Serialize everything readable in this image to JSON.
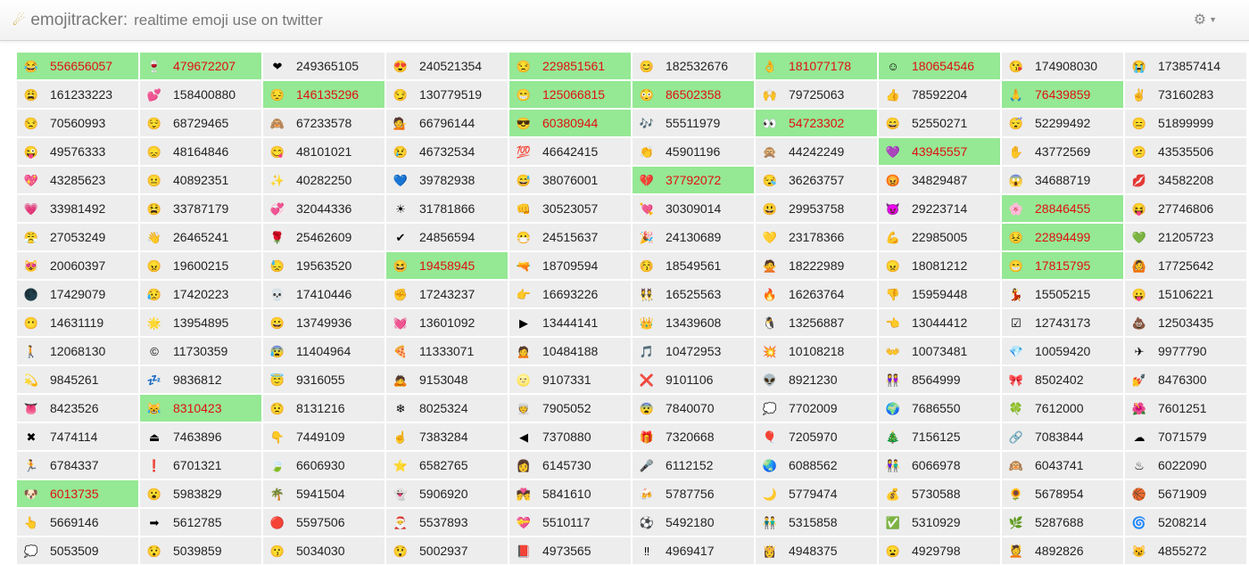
{
  "header": {
    "title": "emojitracker:",
    "subtitle": "realtime emoji use on twitter",
    "logo_icon": "comet-icon",
    "settings_icon": "gears-icon"
  },
  "colors": {
    "highlight_bg": "#95e894",
    "highlight_text": "#e01010",
    "cell_bg": "#ededed"
  },
  "emoji_cells": [
    {
      "emoji": "😂",
      "count": "556656057",
      "highlight": true
    },
    {
      "emoji": "🍷",
      "count": "479672207",
      "highlight": true
    },
    {
      "emoji": "❤",
      "count": "249365105",
      "highlight": false
    },
    {
      "emoji": "😍",
      "count": "240521354",
      "highlight": false
    },
    {
      "emoji": "😒",
      "count": "229851561",
      "highlight": true
    },
    {
      "emoji": "😊",
      "count": "182532676",
      "highlight": false
    },
    {
      "emoji": "👌",
      "count": "181077178",
      "highlight": true
    },
    {
      "emoji": "☺",
      "count": "180654546",
      "highlight": true
    },
    {
      "emoji": "😘",
      "count": "174908030",
      "highlight": false
    },
    {
      "emoji": "😭",
      "count": "173857414",
      "highlight": false
    },
    {
      "emoji": "😩",
      "count": "161233223",
      "highlight": false
    },
    {
      "emoji": "💕",
      "count": "158400880",
      "highlight": false
    },
    {
      "emoji": "😔",
      "count": "146135296",
      "highlight": true
    },
    {
      "emoji": "😏",
      "count": "130779519",
      "highlight": false
    },
    {
      "emoji": "😁",
      "count": "125066815",
      "highlight": true
    },
    {
      "emoji": "😳",
      "count": "86502358",
      "highlight": true
    },
    {
      "emoji": "🙌",
      "count": "79725063",
      "highlight": false
    },
    {
      "emoji": "👍",
      "count": "78592204",
      "highlight": false
    },
    {
      "emoji": "🙏",
      "count": "76439859",
      "highlight": true
    },
    {
      "emoji": "✌",
      "count": "73160283",
      "highlight": false
    },
    {
      "emoji": "😒",
      "count": "70560993",
      "highlight": false
    },
    {
      "emoji": "😌",
      "count": "68729465",
      "highlight": false
    },
    {
      "emoji": "🙈",
      "count": "67233578",
      "highlight": false
    },
    {
      "emoji": "💁",
      "count": "66796144",
      "highlight": false
    },
    {
      "emoji": "😎",
      "count": "60380944",
      "highlight": true
    },
    {
      "emoji": "🎶",
      "count": "55511979",
      "highlight": false
    },
    {
      "emoji": "👀",
      "count": "54723302",
      "highlight": true
    },
    {
      "emoji": "😄",
      "count": "52550271",
      "highlight": false
    },
    {
      "emoji": "😴",
      "count": "52299492",
      "highlight": false
    },
    {
      "emoji": "😑",
      "count": "51899999",
      "highlight": false
    },
    {
      "emoji": "😜",
      "count": "49576333",
      "highlight": false
    },
    {
      "emoji": "😞",
      "count": "48164846",
      "highlight": false
    },
    {
      "emoji": "😋",
      "count": "48101021",
      "highlight": false
    },
    {
      "emoji": "😢",
      "count": "46732534",
      "highlight": false
    },
    {
      "emoji": "💯",
      "count": "46642415",
      "highlight": false
    },
    {
      "emoji": "👏",
      "count": "45901196",
      "highlight": false
    },
    {
      "emoji": "🙊",
      "count": "44242249",
      "highlight": false
    },
    {
      "emoji": "💜",
      "count": "43945557",
      "highlight": true
    },
    {
      "emoji": "✋",
      "count": "43772569",
      "highlight": false
    },
    {
      "emoji": "😕",
      "count": "43535506",
      "highlight": false
    },
    {
      "emoji": "💖",
      "count": "43285623",
      "highlight": false
    },
    {
      "emoji": "😐",
      "count": "40892351",
      "highlight": false
    },
    {
      "emoji": "✨",
      "count": "40282250",
      "highlight": false
    },
    {
      "emoji": "💙",
      "count": "39782938",
      "highlight": false
    },
    {
      "emoji": "😅",
      "count": "38076001",
      "highlight": false
    },
    {
      "emoji": "💔",
      "count": "37792072",
      "highlight": true
    },
    {
      "emoji": "😪",
      "count": "36263757",
      "highlight": false
    },
    {
      "emoji": "😡",
      "count": "34829487",
      "highlight": false
    },
    {
      "emoji": "😱",
      "count": "34688719",
      "highlight": false
    },
    {
      "emoji": "💋",
      "count": "34582208",
      "highlight": false
    },
    {
      "emoji": "💗",
      "count": "33981492",
      "highlight": false
    },
    {
      "emoji": "😫",
      "count": "33787179",
      "highlight": false
    },
    {
      "emoji": "💞",
      "count": "32044336",
      "highlight": false
    },
    {
      "emoji": "☀",
      "count": "31781866",
      "highlight": false
    },
    {
      "emoji": "👊",
      "count": "30523057",
      "highlight": false
    },
    {
      "emoji": "💘",
      "count": "30309014",
      "highlight": false
    },
    {
      "emoji": "😃",
      "count": "29953758",
      "highlight": false
    },
    {
      "emoji": "😈",
      "count": "29223714",
      "highlight": false
    },
    {
      "emoji": "🌸",
      "count": "28846455",
      "highlight": true
    },
    {
      "emoji": "😝",
      "count": "27746806",
      "highlight": false
    },
    {
      "emoji": "😤",
      "count": "27053249",
      "highlight": false
    },
    {
      "emoji": "👋",
      "count": "26465241",
      "highlight": false
    },
    {
      "emoji": "🌹",
      "count": "25462609",
      "highlight": false
    },
    {
      "emoji": "✔",
      "count": "24856594",
      "highlight": false
    },
    {
      "emoji": "😷",
      "count": "24515637",
      "highlight": false
    },
    {
      "emoji": "🎉",
      "count": "24130689",
      "highlight": false
    },
    {
      "emoji": "💛",
      "count": "23178366",
      "highlight": false
    },
    {
      "emoji": "💪",
      "count": "22985005",
      "highlight": false
    },
    {
      "emoji": "😣",
      "count": "22894499",
      "highlight": true
    },
    {
      "emoji": "💚",
      "count": "21205723",
      "highlight": false
    },
    {
      "emoji": "😻",
      "count": "20060397",
      "highlight": false
    },
    {
      "emoji": "😠",
      "count": "19600215",
      "highlight": false
    },
    {
      "emoji": "😓",
      "count": "19563520",
      "highlight": false
    },
    {
      "emoji": "😆",
      "count": "19458945",
      "highlight": true
    },
    {
      "emoji": "🔫",
      "count": "18709594",
      "highlight": false
    },
    {
      "emoji": "😚",
      "count": "18549561",
      "highlight": false
    },
    {
      "emoji": "🙅",
      "count": "18222989",
      "highlight": false
    },
    {
      "emoji": "😠",
      "count": "18081212",
      "highlight": false
    },
    {
      "emoji": "😁",
      "count": "17815795",
      "highlight": true
    },
    {
      "emoji": "🙆",
      "count": "17725642",
      "highlight": false
    },
    {
      "emoji": "🌑",
      "count": "17429079",
      "highlight": false
    },
    {
      "emoji": "😥",
      "count": "17420223",
      "highlight": false
    },
    {
      "emoji": "💀",
      "count": "17410446",
      "highlight": false
    },
    {
      "emoji": "✊",
      "count": "17243237",
      "highlight": false
    },
    {
      "emoji": "👉",
      "count": "16693226",
      "highlight": false
    },
    {
      "emoji": "👯",
      "count": "16525563",
      "highlight": false
    },
    {
      "emoji": "🔥",
      "count": "16263764",
      "highlight": false
    },
    {
      "emoji": "👎",
      "count": "15959448",
      "highlight": false
    },
    {
      "emoji": "💃",
      "count": "15505215",
      "highlight": false
    },
    {
      "emoji": "😛",
      "count": "15106221",
      "highlight": false
    },
    {
      "emoji": "😶",
      "count": "14631119",
      "highlight": false
    },
    {
      "emoji": "🌟",
      "count": "13954895",
      "highlight": false
    },
    {
      "emoji": "😀",
      "count": "13749936",
      "highlight": false
    },
    {
      "emoji": "💓",
      "count": "13601092",
      "highlight": false
    },
    {
      "emoji": "▶",
      "count": "13444141",
      "highlight": false
    },
    {
      "emoji": "👑",
      "count": "13439608",
      "highlight": false
    },
    {
      "emoji": "🐧",
      "count": "13256887",
      "highlight": false
    },
    {
      "emoji": "👈",
      "count": "13044412",
      "highlight": false
    },
    {
      "emoji": "☑",
      "count": "12743173",
      "highlight": false
    },
    {
      "emoji": "💩",
      "count": "12503435",
      "highlight": false
    },
    {
      "emoji": "🚶",
      "count": "12068130",
      "highlight": false
    },
    {
      "emoji": "©",
      "count": "11730359",
      "highlight": false
    },
    {
      "emoji": "😰",
      "count": "11404964",
      "highlight": false
    },
    {
      "emoji": "🍕",
      "count": "11333071",
      "highlight": false
    },
    {
      "emoji": "🙍",
      "count": "10484188",
      "highlight": false
    },
    {
      "emoji": "🎵",
      "count": "10472953",
      "highlight": false
    },
    {
      "emoji": "💥",
      "count": "10108218",
      "highlight": false
    },
    {
      "emoji": "👐",
      "count": "10073481",
      "highlight": false
    },
    {
      "emoji": "💎",
      "count": "10059420",
      "highlight": false
    },
    {
      "emoji": "✈",
      "count": "9977790",
      "highlight": false
    },
    {
      "emoji": "💫",
      "count": "9845261",
      "highlight": false
    },
    {
      "emoji": "💤",
      "count": "9836812",
      "highlight": false
    },
    {
      "emoji": "😇",
      "count": "9316055",
      "highlight": false
    },
    {
      "emoji": "🙇",
      "count": "9153048",
      "highlight": false
    },
    {
      "emoji": "🌝",
      "count": "9107331",
      "highlight": false
    },
    {
      "emoji": "❌",
      "count": "9101106",
      "highlight": false
    },
    {
      "emoji": "👽",
      "count": "8921230",
      "highlight": false
    },
    {
      "emoji": "👭",
      "count": "8564999",
      "highlight": false
    },
    {
      "emoji": "🎀",
      "count": "8502402",
      "highlight": false
    },
    {
      "emoji": "💅",
      "count": "8476300",
      "highlight": false
    },
    {
      "emoji": "👅",
      "count": "8423526",
      "highlight": false
    },
    {
      "emoji": "😹",
      "count": "8310423",
      "highlight": true
    },
    {
      "emoji": "😟",
      "count": "8131216",
      "highlight": false
    },
    {
      "emoji": "❄",
      "count": "8025324",
      "highlight": false
    },
    {
      "emoji": "👳",
      "count": "7905052",
      "highlight": false
    },
    {
      "emoji": "😨",
      "count": "7840070",
      "highlight": false
    },
    {
      "emoji": "💭",
      "count": "7702009",
      "highlight": false
    },
    {
      "emoji": "🌍",
      "count": "7686550",
      "highlight": false
    },
    {
      "emoji": "🍀",
      "count": "7612000",
      "highlight": false
    },
    {
      "emoji": "🌺",
      "count": "7601251",
      "highlight": false
    },
    {
      "emoji": "✖",
      "count": "7474114",
      "highlight": false
    },
    {
      "emoji": "⏏",
      "count": "7463896",
      "highlight": false
    },
    {
      "emoji": "👇",
      "count": "7449109",
      "highlight": false
    },
    {
      "emoji": "☝",
      "count": "7383284",
      "highlight": false
    },
    {
      "emoji": "◀",
      "count": "7370880",
      "highlight": false
    },
    {
      "emoji": "🎁",
      "count": "7320668",
      "highlight": false
    },
    {
      "emoji": "🎈",
      "count": "7205970",
      "highlight": false
    },
    {
      "emoji": "🎄",
      "count": "7156125",
      "highlight": false
    },
    {
      "emoji": "🔗",
      "count": "7083844",
      "highlight": false
    },
    {
      "emoji": "☁",
      "count": "7071579",
      "highlight": false
    },
    {
      "emoji": "🏃",
      "count": "6784337",
      "highlight": false
    },
    {
      "emoji": "❗",
      "count": "6701321",
      "highlight": false
    },
    {
      "emoji": "🍃",
      "count": "6606930",
      "highlight": false
    },
    {
      "emoji": "⭐",
      "count": "6582765",
      "highlight": false
    },
    {
      "emoji": "👩",
      "count": "6145730",
      "highlight": false
    },
    {
      "emoji": "🎤",
      "count": "6112152",
      "highlight": false
    },
    {
      "emoji": "🌏",
      "count": "6088562",
      "highlight": false
    },
    {
      "emoji": "👫",
      "count": "6066978",
      "highlight": false
    },
    {
      "emoji": "🙉",
      "count": "6043741",
      "highlight": false
    },
    {
      "emoji": "♨",
      "count": "6022090",
      "highlight": false
    },
    {
      "emoji": "🐶",
      "count": "6013735",
      "highlight": true
    },
    {
      "emoji": "😮",
      "count": "5983829",
      "highlight": false
    },
    {
      "emoji": "🌴",
      "count": "5941504",
      "highlight": false
    },
    {
      "emoji": "👻",
      "count": "5906920",
      "highlight": false
    },
    {
      "emoji": "💏",
      "count": "5841610",
      "highlight": false
    },
    {
      "emoji": "🍻",
      "count": "5787756",
      "highlight": false
    },
    {
      "emoji": "🌙",
      "count": "5779474",
      "highlight": false
    },
    {
      "emoji": "💰",
      "count": "5730588",
      "highlight": false
    },
    {
      "emoji": "🌻",
      "count": "5678954",
      "highlight": false
    },
    {
      "emoji": "🏀",
      "count": "5671909",
      "highlight": false
    },
    {
      "emoji": "👆",
      "count": "5669146",
      "highlight": false
    },
    {
      "emoji": "➡",
      "count": "5612785",
      "highlight": false
    },
    {
      "emoji": "🔴",
      "count": "5597506",
      "highlight": false
    },
    {
      "emoji": "🎅",
      "count": "5537893",
      "highlight": false
    },
    {
      "emoji": "💝",
      "count": "5510117",
      "highlight": false
    },
    {
      "emoji": "⚽",
      "count": "5492180",
      "highlight": false
    },
    {
      "emoji": "👬",
      "count": "5315858",
      "highlight": false
    },
    {
      "emoji": "✅",
      "count": "5310929",
      "highlight": false
    },
    {
      "emoji": "🌿",
      "count": "5287688",
      "highlight": false
    },
    {
      "emoji": "🌀",
      "count": "5208214",
      "highlight": false
    },
    {
      "emoji": "💭",
      "count": "5053509",
      "highlight": false
    },
    {
      "emoji": "😯",
      "count": "5039859",
      "highlight": false
    },
    {
      "emoji": "😗",
      "count": "5034030",
      "highlight": false
    },
    {
      "emoji": "😲",
      "count": "5002937",
      "highlight": false
    },
    {
      "emoji": "📕",
      "count": "4973565",
      "highlight": false
    },
    {
      "emoji": "‼",
      "count": "4969417",
      "highlight": false
    },
    {
      "emoji": "👸",
      "count": "4948375",
      "highlight": false
    },
    {
      "emoji": "😦",
      "count": "4929798",
      "highlight": false
    },
    {
      "emoji": "💆",
      "count": "4892826",
      "highlight": false
    },
    {
      "emoji": "😼",
      "count": "4855272",
      "highlight": false
    }
  ]
}
